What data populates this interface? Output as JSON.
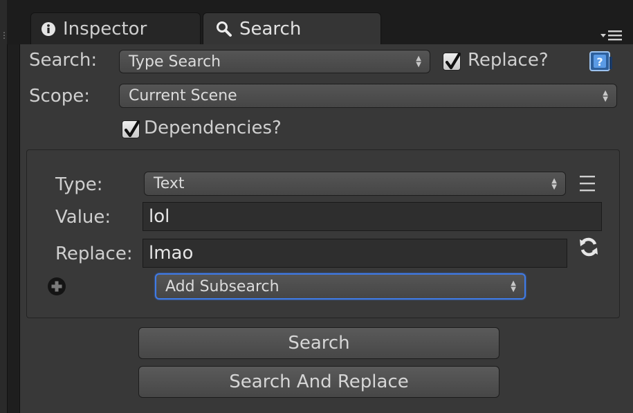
{
  "tabs": {
    "inspector_label": "Inspector",
    "search_label": "Search"
  },
  "search_row": {
    "label": "Search:",
    "value": "Type Search",
    "replace_checked": true,
    "replace_label": "Replace?"
  },
  "scope_row": {
    "label": "Scope:",
    "value": "Current Scene"
  },
  "dependencies": {
    "checked": true,
    "label": "Dependencies?"
  },
  "subsearch": {
    "type_label": "Type:",
    "type_value": "Text",
    "value_label": "Value:",
    "value_text": "lol",
    "replace_label": "Replace:",
    "replace_text": "lmao",
    "add_value": "Add Subsearch"
  },
  "buttons": {
    "search": "Search",
    "search_and_replace": "Search And Replace"
  },
  "colors": {
    "panel": "#383838",
    "focus_outline": "#3f7be8",
    "help_icon": "#4a8de0"
  }
}
